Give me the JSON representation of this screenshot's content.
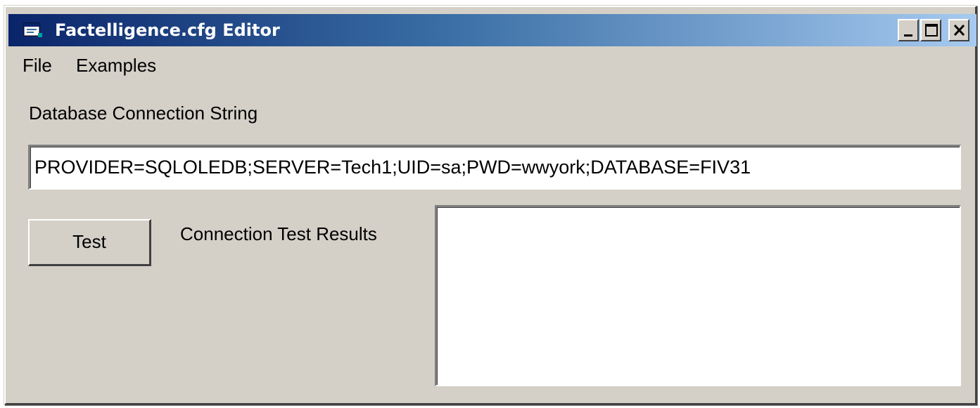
{
  "window": {
    "title": "Factelligence.cfg Editor",
    "titlebar_colors": [
      "#0a246a",
      "#a6caf0"
    ],
    "buttons": [
      {
        "name": "minimize",
        "icon": "minimize-icon"
      },
      {
        "name": "maximize",
        "icon": "maximize-icon"
      },
      {
        "name": "close",
        "icon": "close-icon"
      }
    ]
  },
  "menubar": {
    "items": [
      {
        "label": "File"
      },
      {
        "label": "Examples"
      }
    ]
  },
  "connection": {
    "label": "Database Connection String",
    "value": "PROVIDER=SQLOLEDB;SERVER=Tech1;UID=sa;PWD=wwyork;DATABASE=FIV31"
  },
  "test": {
    "button_label": "Test",
    "results_label": "Connection Test Results",
    "results_value": ""
  }
}
